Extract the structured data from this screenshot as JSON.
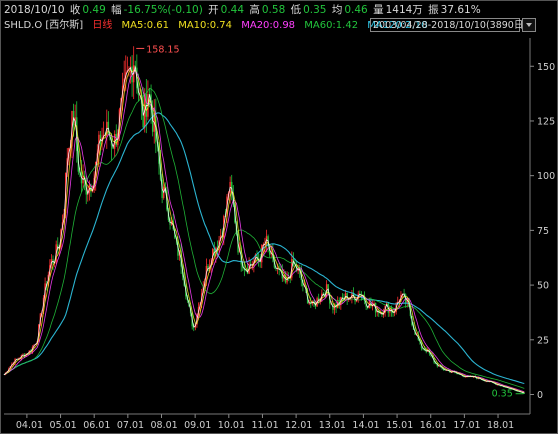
{
  "header": {
    "date": "2018/10/10",
    "close_label": "收",
    "close_value": "0.49",
    "change_label": "幅",
    "change_value": "-16.75%(-0.10)",
    "open_label": "开",
    "open_value": "0.44",
    "high_label": "高",
    "high_value": "0.58",
    "low_label": "低",
    "low_value": "0.35",
    "avg_label": "均",
    "avg_value": "0.46",
    "volume_label": "量",
    "volume_value": "1414万",
    "amplitude_label": "振",
    "amplitude_value": "37.61%"
  },
  "legend": {
    "symbol": "SHLD.O [西尔斯]",
    "period": "日线",
    "ma5": "MA5:0.61",
    "ma10": "MA10:0.74",
    "ma20": "MA20:0.98",
    "ma60": "MA60:1.42",
    "ma120": "MA120:2.10",
    "range": "2003/04/28-2018/10/10(3890日)"
  },
  "colors": {
    "up": "#ff3030",
    "down": "#22c43c",
    "ma5": "#ffffff",
    "ma10": "#f0e020",
    "ma20": "#ff40ff",
    "ma60": "#22c43c",
    "ma120": "#30c8e8"
  },
  "chart_data": {
    "type": "line",
    "title": "",
    "ylim": [
      -8,
      162
    ],
    "yticks": [
      0,
      25,
      50,
      75,
      100,
      125,
      150
    ],
    "xticks": [
      "04.01",
      "05.01",
      "06.01",
      "07.01",
      "08.01",
      "09.01",
      "10.01",
      "11.01",
      "12.01",
      "13.01",
      "14.01",
      "15.01",
      "16.01",
      "17.01",
      "18.01"
    ],
    "series": [
      {
        "name": "",
        "x": [
          2003.32,
          2003.6,
          2003.9,
          2004.1,
          2004.3,
          2004.5,
          2004.7,
          2004.8,
          2004.95,
          2005.1,
          2005.2,
          2005.3,
          2005.4,
          2005.5,
          2005.6,
          2005.8,
          2006.0,
          2006.2,
          2006.4,
          2006.6,
          2006.8,
          2006.95,
          2007.1,
          2007.2,
          2007.3,
          2007.45,
          2007.6,
          2007.8,
          2008.0,
          2008.2,
          2008.4,
          2008.6,
          2008.8,
          2008.95,
          2009.1,
          2009.3,
          2009.5,
          2009.7,
          2009.9,
          2010.0,
          2010.15,
          2010.3,
          2010.5,
          2010.7,
          2010.9,
          2011.1,
          2011.3,
          2011.5,
          2011.7,
          2011.9,
          2012.1,
          2012.3,
          2012.5,
          2012.7,
          2012.9,
          2013.1,
          2013.3,
          2013.5,
          2013.7,
          2013.9,
          2014.1,
          2014.3,
          2014.5,
          2014.7,
          2014.9,
          2015.1,
          2015.3,
          2015.5,
          2015.7,
          2015.9,
          2016.1,
          2016.3,
          2016.5,
          2016.7,
          2016.9,
          2017.1,
          2017.3,
          2017.5,
          2017.7,
          2017.9,
          2018.1,
          2018.3,
          2018.5,
          2018.7,
          2018.78
        ],
        "y": [
          9,
          15,
          18,
          20,
          25,
          45,
          60,
          62,
          68,
          85,
          110,
          120,
          128,
          108,
          98,
          95,
          100,
          118,
          120,
          115,
          130,
          142,
          150,
          155,
          140,
          125,
          140,
          120,
          95,
          85,
          70,
          60,
          40,
          30,
          40,
          55,
          65,
          70,
          82,
          95,
          85,
          65,
          58,
          60,
          62,
          70,
          60,
          55,
          50,
          60,
          55,
          45,
          40,
          45,
          48,
          40,
          42,
          45,
          44,
          47,
          42,
          40,
          38,
          40,
          38,
          45,
          42,
          30,
          22,
          20,
          15,
          12,
          11,
          10,
          9,
          8,
          8,
          7,
          6,
          5,
          4,
          3,
          2,
          1,
          0.49
        ]
      }
    ],
    "annotations": {
      "high": "158.15",
      "low": "0.35"
    }
  }
}
